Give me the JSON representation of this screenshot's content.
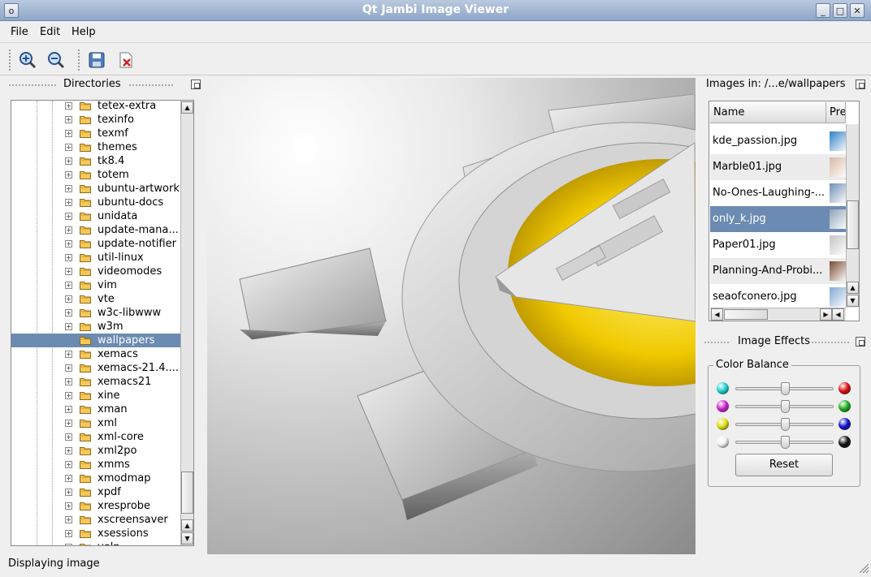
{
  "window": {
    "title": "Qt Jambi Image Viewer"
  },
  "menu": {
    "items": [
      "File",
      "Edit",
      "Help"
    ]
  },
  "toolbar": {
    "tools": [
      "zoom-in-icon",
      "zoom-out-icon",
      "save-icon",
      "close-file-icon"
    ]
  },
  "directories": {
    "title": "Directories",
    "items": [
      {
        "label": "tetex-extra",
        "selected": false
      },
      {
        "label": "texinfo",
        "selected": false
      },
      {
        "label": "texmf",
        "selected": false
      },
      {
        "label": "themes",
        "selected": false
      },
      {
        "label": "tk8.4",
        "selected": false
      },
      {
        "label": "totem",
        "selected": false
      },
      {
        "label": "ubuntu-artwork",
        "selected": false
      },
      {
        "label": "ubuntu-docs",
        "selected": false
      },
      {
        "label": "unidata",
        "selected": false
      },
      {
        "label": "update-mana...",
        "selected": false
      },
      {
        "label": "update-notifier",
        "selected": false
      },
      {
        "label": "util-linux",
        "selected": false
      },
      {
        "label": "videomodes",
        "selected": false
      },
      {
        "label": "vim",
        "selected": false
      },
      {
        "label": "vte",
        "selected": false
      },
      {
        "label": "w3c-libwww",
        "selected": false
      },
      {
        "label": "w3m",
        "selected": false
      },
      {
        "label": "wallpapers",
        "selected": true
      },
      {
        "label": "xemacs",
        "selected": false
      },
      {
        "label": "xemacs-21.4....",
        "selected": false
      },
      {
        "label": "xemacs21",
        "selected": false
      },
      {
        "label": "xine",
        "selected": false
      },
      {
        "label": "xman",
        "selected": false
      },
      {
        "label": "xml",
        "selected": false
      },
      {
        "label": "xml-core",
        "selected": false
      },
      {
        "label": "xml2po",
        "selected": false
      },
      {
        "label": "xmms",
        "selected": false
      },
      {
        "label": "xmodmap",
        "selected": false
      },
      {
        "label": "xpdf",
        "selected": false
      },
      {
        "label": "xresprobe",
        "selected": false
      },
      {
        "label": "xscreensaver",
        "selected": false
      },
      {
        "label": "xsessions",
        "selected": false
      },
      {
        "label": "yelp",
        "selected": false
      }
    ]
  },
  "images_panel": {
    "title": "Images in: /...e/wallpapers",
    "columns": [
      "Name",
      "Pre"
    ],
    "files": [
      {
        "name": "kde_passion.jpg",
        "selected": false,
        "thumb": "#2f7fc7"
      },
      {
        "name": "Marble01.jpg",
        "selected": false,
        "thumb": "#d8b9a4"
      },
      {
        "name": "No-Ones-Laughing-...",
        "selected": false,
        "thumb": "#6f8fb7"
      },
      {
        "name": "only_k.jpg",
        "selected": true,
        "thumb": "#8ea3b8"
      },
      {
        "name": "Paper01.jpg",
        "selected": false,
        "thumb": "#c6c6c6"
      },
      {
        "name": "Planning-And-Probi...",
        "selected": false,
        "thumb": "#7a4a33"
      },
      {
        "name": "seaofconero.jpg",
        "selected": false,
        "thumb": "#7fa9d4"
      }
    ]
  },
  "effects": {
    "title": "Image Effects",
    "group_title": "Color Balance",
    "sliders": [
      {
        "left_color": "#20d0d0",
        "right_color": "#e01010",
        "value": 0.5
      },
      {
        "left_color": "#d020d0",
        "right_color": "#20b020",
        "value": 0.5
      },
      {
        "left_color": "#e0e010",
        "right_color": "#1010d0",
        "value": 0.5
      },
      {
        "left_color": "#f0f0f0",
        "right_color": "#101010",
        "value": 0.5
      }
    ],
    "reset_label": "Reset"
  },
  "status": {
    "text": "Displaying image"
  }
}
